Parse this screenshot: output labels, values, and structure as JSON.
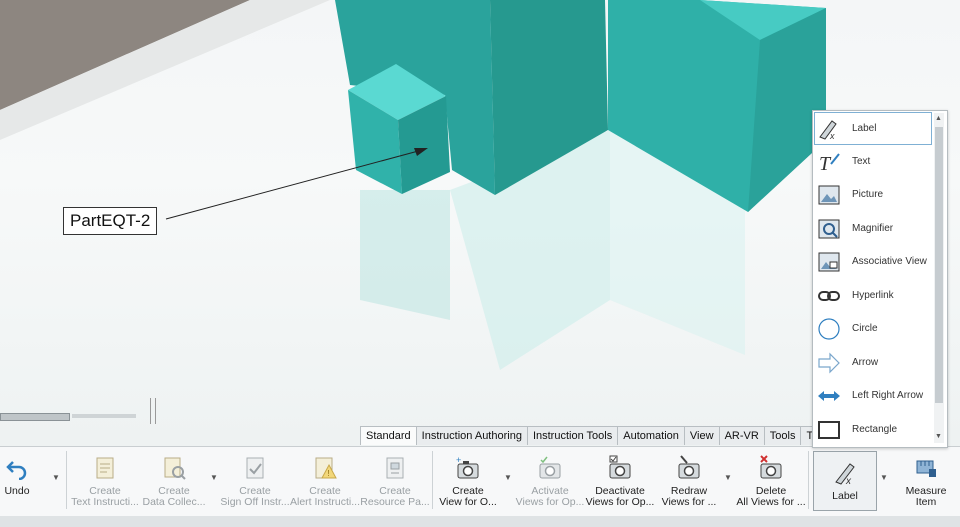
{
  "viewport": {
    "callout_label": "PartEQT-2"
  },
  "tabs": [
    {
      "label": "Standard",
      "active": true
    },
    {
      "label": "Instruction Authoring",
      "active": false
    },
    {
      "label": "Instruction Tools",
      "active": false
    },
    {
      "label": "Automation",
      "active": false
    },
    {
      "label": "View",
      "active": false
    },
    {
      "label": "AR-VR",
      "active": false
    },
    {
      "label": "Tools",
      "active": false
    },
    {
      "label": "Tou",
      "active": false
    }
  ],
  "ribbon": {
    "undo": {
      "line1": "Undo"
    },
    "create_text": {
      "line1": "Create",
      "line2": "Text Instructi..."
    },
    "create_data": {
      "line1": "Create",
      "line2": "Data Collec..."
    },
    "create_signoff": {
      "line1": "Create",
      "line2": "Sign Off Instr..."
    },
    "create_alert": {
      "line1": "Create",
      "line2": "Alert Instructi..."
    },
    "create_resource": {
      "line1": "Create",
      "line2": "Resource Pa..."
    },
    "create_view": {
      "line1": "Create",
      "line2": "View for O..."
    },
    "activate_views": {
      "line1": "Activate",
      "line2": "Views for Op..."
    },
    "deactivate_views": {
      "line1": "Deactivate",
      "line2": "Views for Op..."
    },
    "redraw_views": {
      "line1": "Redraw",
      "line2": "Views for ..."
    },
    "delete_views": {
      "line1": "Delete",
      "line2": "All Views for ..."
    },
    "label": {
      "line1": "Label"
    },
    "measure": {
      "line1": "Measure",
      "line2": "Item"
    }
  },
  "dropdown": {
    "items": [
      {
        "label": "Label",
        "icon": "label-pen-icon"
      },
      {
        "label": "Text",
        "icon": "text-icon"
      },
      {
        "label": "Picture",
        "icon": "picture-icon"
      },
      {
        "label": "Magnifier",
        "icon": "magnifier-icon"
      },
      {
        "label": "Associative View",
        "icon": "associative-view-icon"
      },
      {
        "label": "Hyperlink",
        "icon": "hyperlink-icon"
      },
      {
        "label": "Circle",
        "icon": "circle-icon"
      },
      {
        "label": "Arrow",
        "icon": "arrow-icon"
      },
      {
        "label": "Left Right Arrow",
        "icon": "left-right-arrow-icon"
      },
      {
        "label": "Rectangle",
        "icon": "rectangle-icon"
      }
    ]
  },
  "colors": {
    "part_teal": "#2ea8a2",
    "part_teal_light": "#52d6cf",
    "accent_blue": "#2f7fc0"
  }
}
